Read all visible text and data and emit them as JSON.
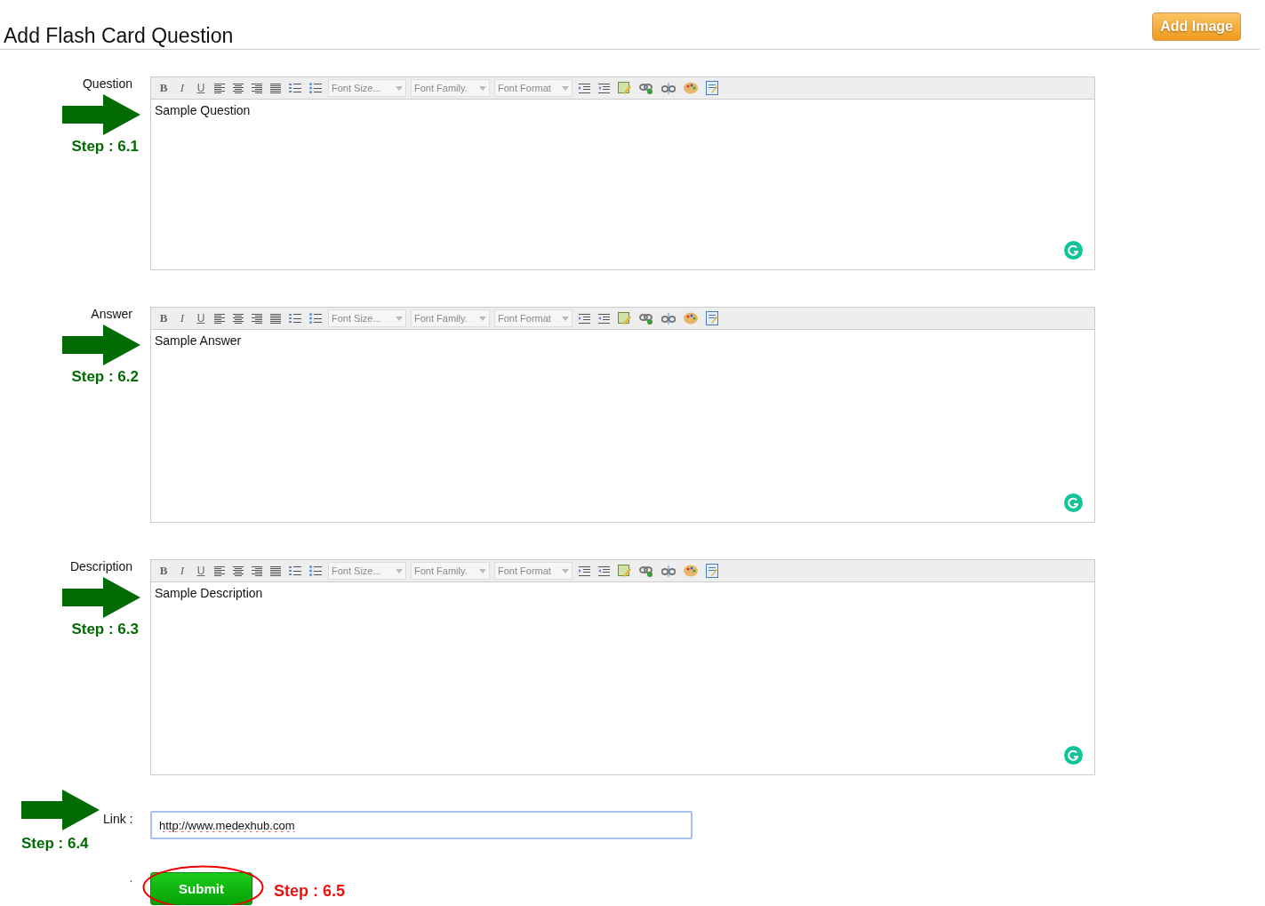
{
  "header": {
    "title": "Add Flash Card Question",
    "add_image_button": "Add Image"
  },
  "editors": [
    {
      "label": "Question",
      "step": "Step : 6.1",
      "toolbar": {
        "format_buttons": [
          "B",
          "I",
          "U"
        ],
        "dropdowns": [
          "Font Size...",
          "Font Family.",
          "Font Format"
        ]
      },
      "content": "Sample Question"
    },
    {
      "label": "Answer",
      "step": "Step : 6.2",
      "toolbar": {
        "format_buttons": [
          "B",
          "I",
          "U"
        ],
        "dropdowns": [
          "Font Size...",
          "Font Family.",
          "Font Format"
        ]
      },
      "content": "Sample Answer"
    },
    {
      "label": "Description",
      "step": "Step : 6.3",
      "toolbar": {
        "format_buttons": [
          "B",
          "I",
          "U"
        ],
        "dropdowns": [
          "Font Size...",
          "Font Family.",
          "Font Format"
        ]
      },
      "content": "Sample Description"
    }
  ],
  "link": {
    "label": "Link :",
    "step": "Step : 6.4",
    "value": "http://www.medexhub.com"
  },
  "submit": {
    "mark": ".",
    "button": "Submit",
    "step": "Step : 6.5"
  }
}
